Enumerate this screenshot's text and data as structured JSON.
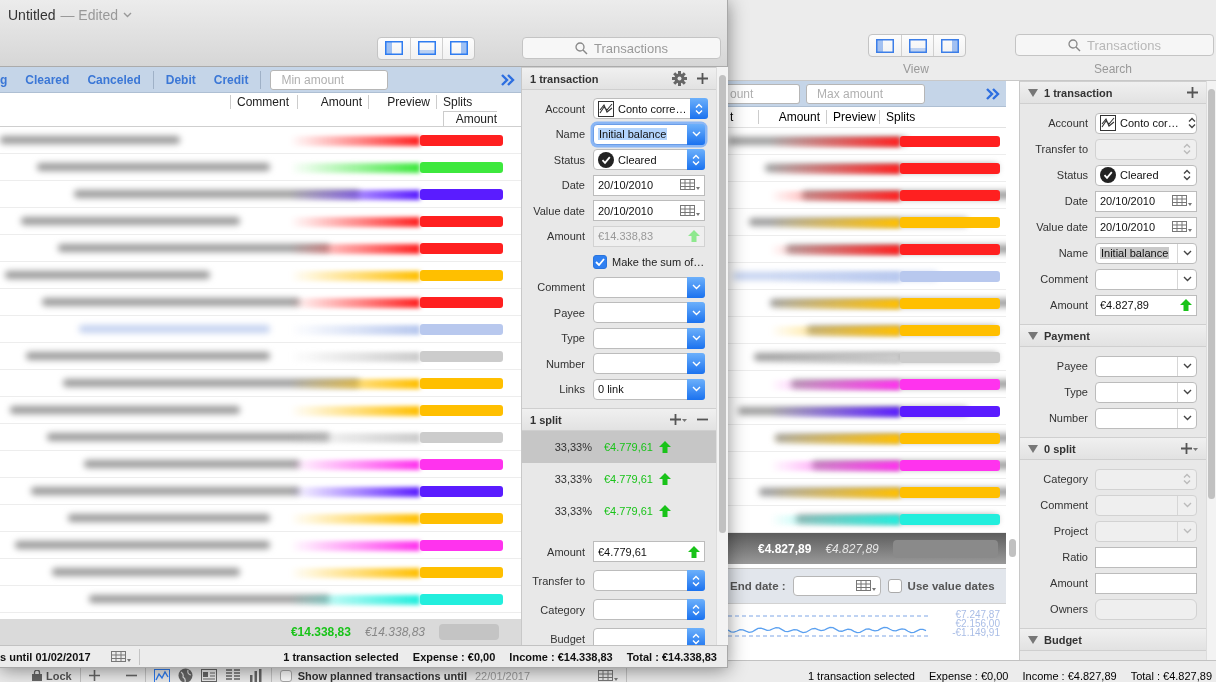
{
  "front_window": {
    "active": true,
    "title": "Untitled",
    "edited": "— Edited",
    "search": {
      "placeholder": "Transactions"
    },
    "filter_groups": [
      [
        "g",
        "Cleared",
        "Canceled"
      ],
      [
        "Debit",
        "Credit"
      ]
    ],
    "min_amount": {
      "placeholder": "Min amount"
    },
    "columns": [
      "Comment",
      "Amount",
      "Preview",
      "Splits"
    ],
    "sub_column": "Amount",
    "rows": [
      {
        "color": "#ff2020"
      },
      {
        "color": "#3de83d"
      },
      {
        "color": "#5a1cff"
      },
      {
        "color": "#ff2020"
      },
      {
        "color": "#ff2020"
      },
      {
        "color": "#ffbf00"
      },
      {
        "color": "#ff2020"
      },
      {
        "color": "#b8c8ee"
      },
      {
        "color": "#cccccc"
      },
      {
        "color": "#ffbf00"
      },
      {
        "color": "#ffbf00"
      },
      {
        "color": "#cccccc"
      },
      {
        "color": "#ff33ee"
      },
      {
        "color": "#5a1cff"
      },
      {
        "color": "#ffbf00"
      },
      {
        "color": "#ff33ee"
      },
      {
        "color": "#ffbf00"
      },
      {
        "color": "#22eedd"
      }
    ],
    "totals": {
      "amount": "€14.338,83",
      "preview": "€14.338,83"
    },
    "status": {
      "period": "s until 01/02/2017",
      "items": [
        "1 transaction selected",
        "Expense : €0,00",
        "Income : €14.338,83",
        "Total : €14.338,83"
      ]
    },
    "inspector": [
      {
        "title": "1 transaction",
        "buttons": [
          {
            "kind": "settings"
          },
          {
            "kind": "add"
          }
        ],
        "fields": [
          {
            "label": "Account",
            "kind": "account",
            "value": "Conto corre…",
            "disabled": false
          },
          {
            "label": "Name",
            "kind": "combo",
            "value": "Initial balance",
            "disabled": false,
            "highlighted": true
          },
          {
            "label": "Status",
            "kind": "status",
            "value": "Cleared",
            "disabled": false
          },
          {
            "label": "Date",
            "kind": "date",
            "value": "20/10/2010",
            "disabled": false
          },
          {
            "label": "Value date",
            "kind": "date",
            "value": "20/10/2010",
            "disabled": false
          },
          {
            "label": "Amount",
            "kind": "amount",
            "value": "€14.338,83",
            "disabled": true
          },
          {
            "kind": "checkbox",
            "value": "Make the sum of…",
            "checked": true
          },
          {
            "label": "Comment",
            "kind": "combo",
            "disabled": false
          },
          {
            "label": "Payee",
            "kind": "combo",
            "disabled": false
          },
          {
            "label": "Type",
            "kind": "combo",
            "disabled": false
          },
          {
            "label": "Number",
            "kind": "combo",
            "disabled": false
          },
          {
            "label": "Links",
            "kind": "combo",
            "value": "0 link",
            "disabled": false
          }
        ]
      },
      {
        "title": "1 split",
        "buttons": [
          {
            "kind": "add-menu"
          },
          {
            "kind": "remove"
          }
        ],
        "splits": [
          {
            "ratio": "33,33%",
            "amount": "€4.779,61",
            "selected": true
          },
          {
            "ratio": "33,33%",
            "amount": "€4.779,61",
            "selected": false
          },
          {
            "ratio": "33,33%",
            "amount": "€4.779,61",
            "selected": false
          }
        ],
        "fields": [
          {
            "label": "Amount",
            "kind": "amount",
            "value": "€4.779,61",
            "disabled": false
          },
          {
            "label": "Transfer to",
            "kind": "popup",
            "disabled": false
          },
          {
            "label": "Category",
            "kind": "popup",
            "disabled": false
          },
          {
            "label": "Budget",
            "kind": "popup",
            "disabled": false
          }
        ]
      }
    ]
  },
  "back_window": {
    "active": false,
    "view_label": "View",
    "search_label": "Search",
    "search": {
      "placeholder": "Transactions"
    },
    "amount_fields": [
      {
        "placeholder": "ount"
      },
      {
        "placeholder": "Max amount"
      }
    ],
    "columns": [
      "t",
      "Amount",
      "Preview",
      "Splits"
    ],
    "rows": [
      {
        "color": "#ff2020"
      },
      {
        "color": "#ff2020"
      },
      {
        "color": "#ff2020"
      },
      {
        "color": "#ffbf00"
      },
      {
        "color": "#ff2020"
      },
      {
        "color": "#b8c8ee"
      },
      {
        "color": "#ffbf00"
      },
      {
        "color": "#ffbf00"
      },
      {
        "color": "#cccccc"
      },
      {
        "color": "#ff33ee"
      },
      {
        "color": "#5a1cff"
      },
      {
        "color": "#ffbf00"
      },
      {
        "color": "#ff33ee"
      },
      {
        "color": "#ffbf00"
      },
      {
        "color": "#22eedd"
      }
    ],
    "totals": {
      "amount": "€4.827,89",
      "preview": "€4.827,89"
    },
    "end_date": {
      "label": "End date :"
    },
    "use_value_dates": {
      "label": "Use value dates",
      "checked": false
    },
    "balance_labels": [
      "€7.247,87",
      "€2.156,00",
      "-€1.149,91"
    ],
    "bottom_bar": {
      "lock": "Lock",
      "planned": {
        "label": "Show planned transactions until",
        "checked": false
      },
      "planned_date": "22/01/2017"
    },
    "status": {
      "items": [
        "1 transaction selected",
        "Expense : €0,00",
        "Income : €4.827,89",
        "Total : €4.827,89"
      ]
    },
    "inspector": [
      {
        "title": "1 transaction",
        "expanded": true,
        "buttons": [
          {
            "kind": "add"
          }
        ],
        "fields": [
          {
            "label": "Account",
            "kind": "account",
            "value": "Conto cor…",
            "disabled": false
          },
          {
            "label": "Transfer to",
            "kind": "popup",
            "disabled": true
          },
          {
            "label": "Status",
            "kind": "status",
            "value": "Cleared",
            "disabled": false
          },
          {
            "label": "Date",
            "kind": "date",
            "value": "20/10/2010",
            "disabled": false
          },
          {
            "label": "Value date",
            "kind": "date",
            "value": "20/10/2010",
            "disabled": false
          },
          {
            "label": "Name",
            "kind": "combo",
            "value": "Initial balance",
            "disabled": false,
            "highlighted": true
          },
          {
            "label": "Comment",
            "kind": "combo",
            "disabled": false
          },
          {
            "label": "Amount",
            "kind": "amount",
            "value": "€4.827,89",
            "disabled": false
          }
        ]
      },
      {
        "title": "Payment",
        "expanded": true,
        "fields": [
          {
            "label": "Payee",
            "kind": "combo",
            "disabled": false
          },
          {
            "label": "Type",
            "kind": "combo",
            "disabled": false
          },
          {
            "label": "Number",
            "kind": "combo",
            "disabled": false
          }
        ]
      },
      {
        "title": "0 split",
        "expanded": true,
        "buttons": [
          {
            "kind": "add-menu"
          }
        ],
        "fields": [
          {
            "label": "Category",
            "kind": "popup",
            "disabled": true
          },
          {
            "label": "Comment",
            "kind": "combo",
            "disabled": true
          },
          {
            "label": "Project",
            "kind": "combo",
            "disabled": true
          },
          {
            "label": "Ratio",
            "kind": "text",
            "disabled": false
          },
          {
            "label": "Amount",
            "kind": "text",
            "disabled": false
          },
          {
            "label": "Owners",
            "kind": "tokens",
            "disabled": true
          }
        ]
      },
      {
        "title": "Budget",
        "expanded": true
      }
    ]
  }
}
